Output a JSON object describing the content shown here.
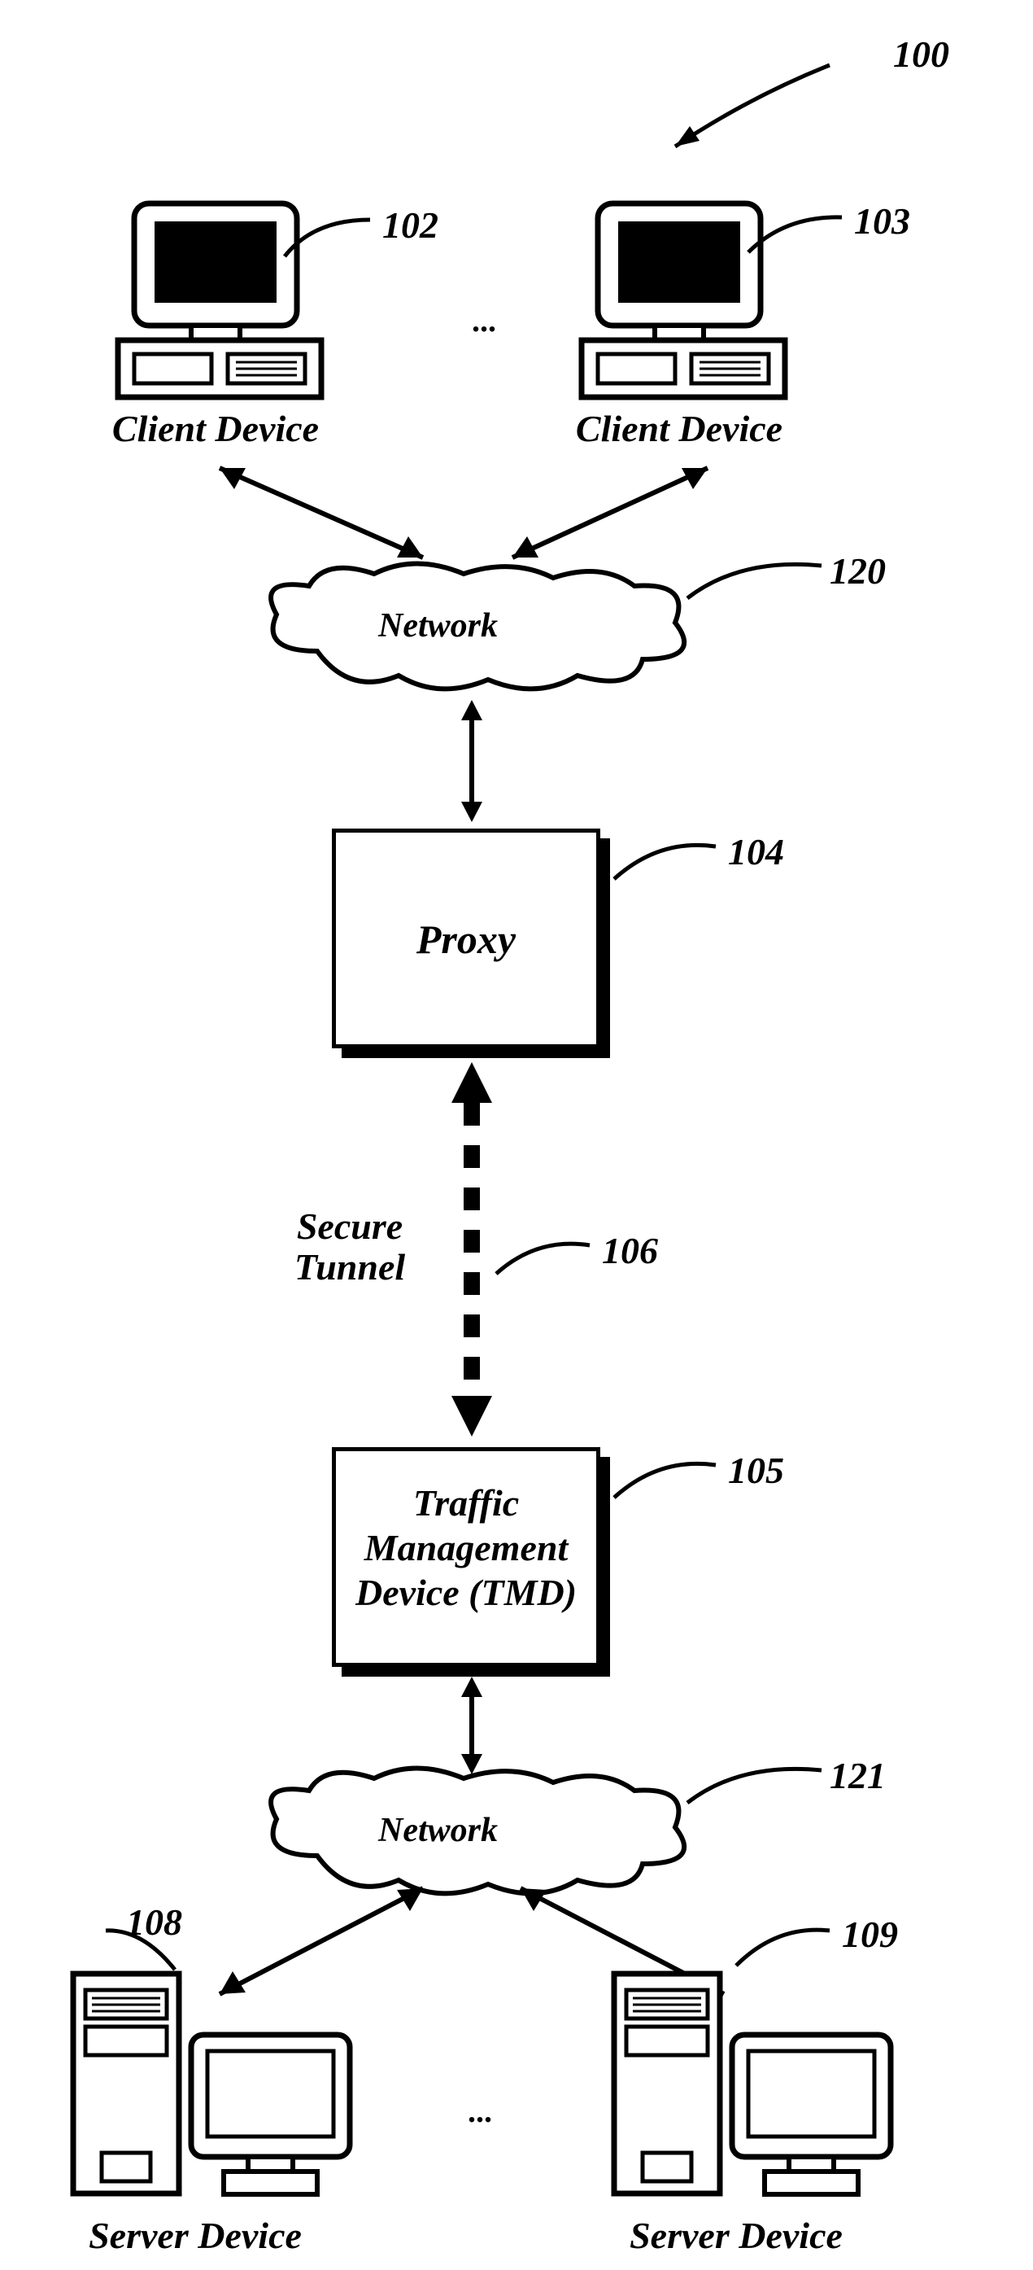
{
  "labels": {
    "n100": "100",
    "n102": "102",
    "n103": "103",
    "n104": "104",
    "n105": "105",
    "n106": "106",
    "n108": "108",
    "n109": "109",
    "n120": "120",
    "n121": "121"
  },
  "text": {
    "client_device": "Client Device",
    "network": "Network",
    "proxy": "Proxy",
    "secure_tunnel_1": "Secure",
    "secure_tunnel_2": "Tunnel",
    "tmd_1": "Traffic",
    "tmd_2": "Management",
    "tmd_3": "Device (TMD)",
    "server_device": "Server Device",
    "ellipsis": "..."
  }
}
